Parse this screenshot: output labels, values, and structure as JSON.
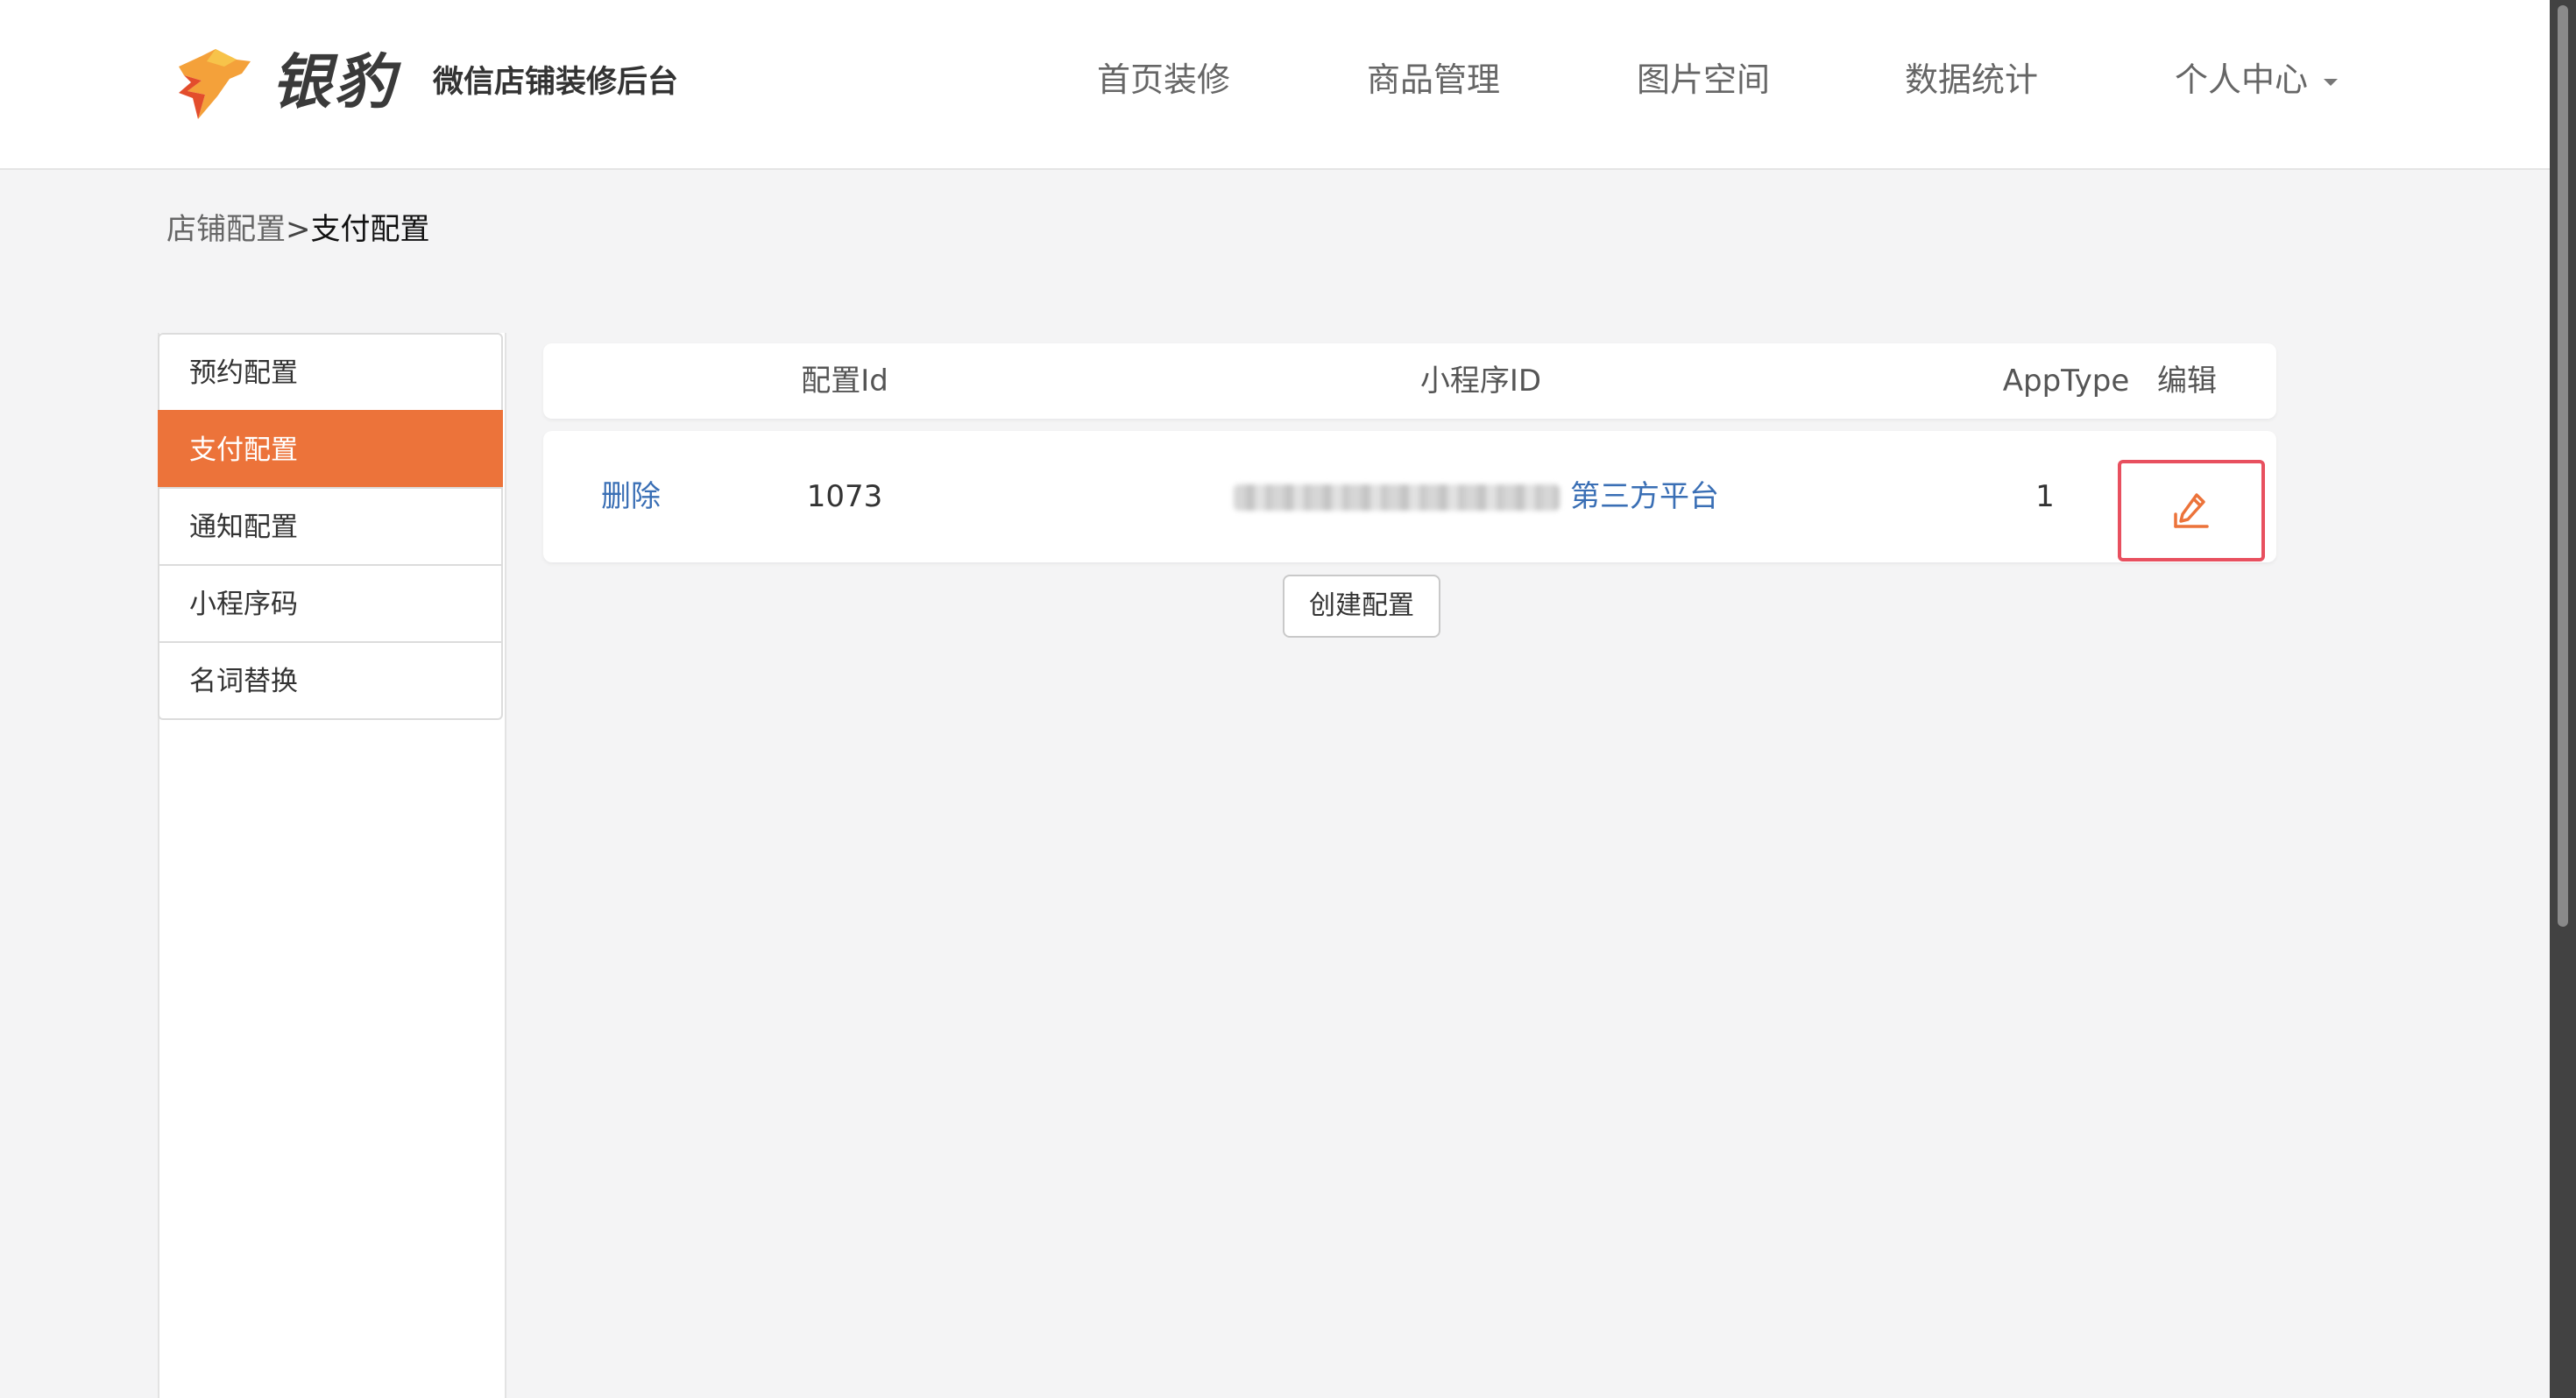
{
  "header": {
    "brand": "银豹",
    "subtitle": "微信店铺装修后台",
    "nav": [
      "首页装修",
      "商品管理",
      "图片空间",
      "数据统计",
      "个人中心"
    ]
  },
  "breadcrumb": {
    "parent": "店铺配置",
    "separator": ">",
    "current": "支付配置"
  },
  "sidebar": {
    "items": [
      "预约配置",
      "支付配置",
      "通知配置",
      "小程序码",
      "名词替换"
    ],
    "active_index": 1
  },
  "table": {
    "headers": [
      "配置Id",
      "小程序ID",
      "AppType",
      "编辑"
    ],
    "rows": [
      {
        "action": "删除",
        "config_id": "1073",
        "mini_program_suffix": "第三方平台",
        "app_type": "1"
      }
    ]
  },
  "create_button": "创建配置",
  "icons": {
    "logo": "leopard-logo-icon",
    "edit": "pencil-edit-icon",
    "dropdown": "caret-down-icon"
  },
  "colors": {
    "accent": "#ec733a",
    "link": "#3a6fb5",
    "highlight_border": "#e8505f",
    "background": "#f4f4f5"
  }
}
